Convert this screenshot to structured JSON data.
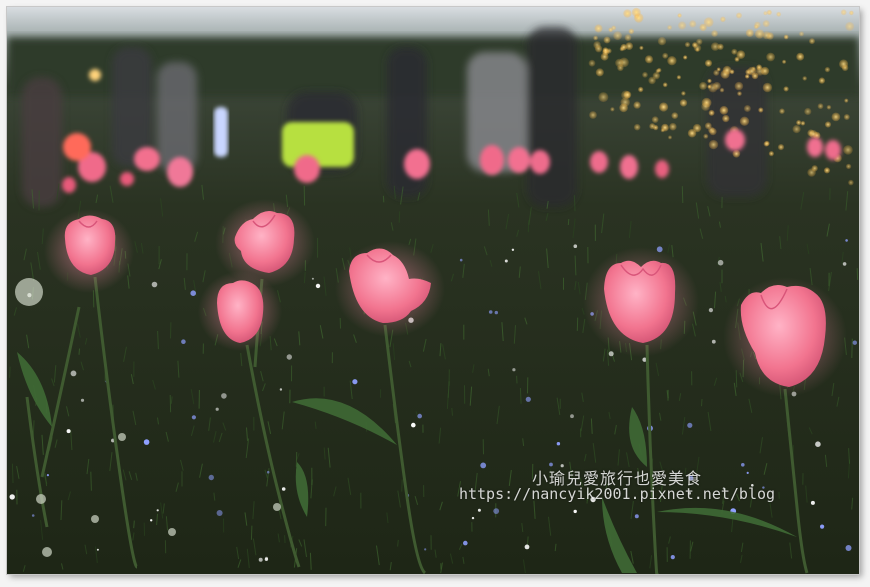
{
  "scene": {
    "subject": "pink illuminated tulip lamps in grass at dusk",
    "colors": {
      "tulip": "#f07a9a",
      "tulip_glow": "#ff9ab3",
      "grass": "#2e3a22",
      "sky": "#d9dee2",
      "lights": "#ffc44d"
    }
  },
  "watermark": {
    "title": "小瑜兒愛旅行也愛美食",
    "url": "https://nancyik2001.pixnet.net/blog"
  }
}
